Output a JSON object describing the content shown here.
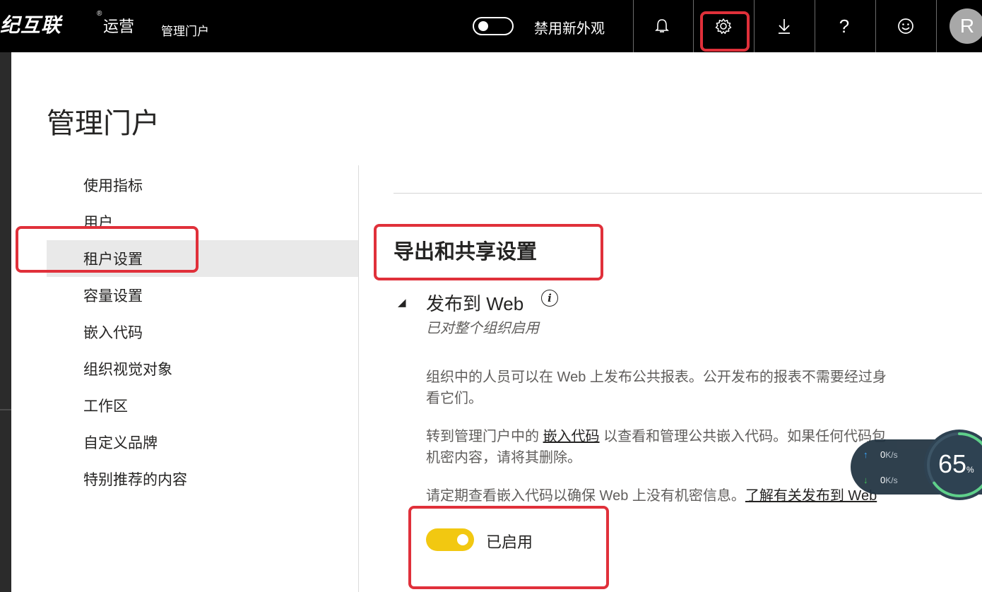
{
  "header": {
    "brand": "纪互联",
    "brand_mark": "®",
    "brand_suffix": "运营",
    "app_name": "管理门户",
    "new_look_label": "禁用新外观",
    "icons": [
      "bell-icon",
      "gear-icon",
      "download-icon",
      "help-icon",
      "smiley-icon"
    ],
    "help_glyph": "?",
    "avatar_initial": "R"
  },
  "page": {
    "title": "管理门户"
  },
  "nav": {
    "items": [
      {
        "label": "使用指标"
      },
      {
        "label": "用户"
      },
      {
        "label": "租户设置",
        "active": true
      },
      {
        "label": "容量设置"
      },
      {
        "label": "嵌入代码"
      },
      {
        "label": "组织视觉对象"
      },
      {
        "label": "工作区"
      },
      {
        "label": "自定义品牌"
      },
      {
        "label": "特别推荐的内容"
      }
    ]
  },
  "section": {
    "title": "导出和共享设置"
  },
  "setting": {
    "caret": "◢",
    "title": "发布到 Web",
    "info_glyph": "i",
    "status": "已对整个组织启用",
    "para1_line1": "组织中的人员可以在 Web 上发布公共报表。公开发布的报表不需要经过身",
    "para1_line2": "看它们。",
    "para2_prefix": "转到管理门户中的 ",
    "para2_link": "嵌入代码",
    "para2_suffix": " 以查看和管理公共嵌入代码。如果任何代码包",
    "para2_line2": "机密内容，请将其删除。",
    "para3_text": "请定期查看嵌入代码以确保 Web 上没有机密信息。",
    "para3_link": "了解有关发布到 Web",
    "toggle_label": "已启用",
    "enabled": true
  },
  "net_widget": {
    "up_value": "0",
    "down_value": "0",
    "unit": "K/s",
    "percent": "65",
    "percent_sign": "%",
    "percent_value": 0.65
  },
  "colors": {
    "topbar": "#000000",
    "accent_toggle": "#f2c811",
    "highlight": "#e0303a",
    "nav_active": "#e9e9e9"
  }
}
